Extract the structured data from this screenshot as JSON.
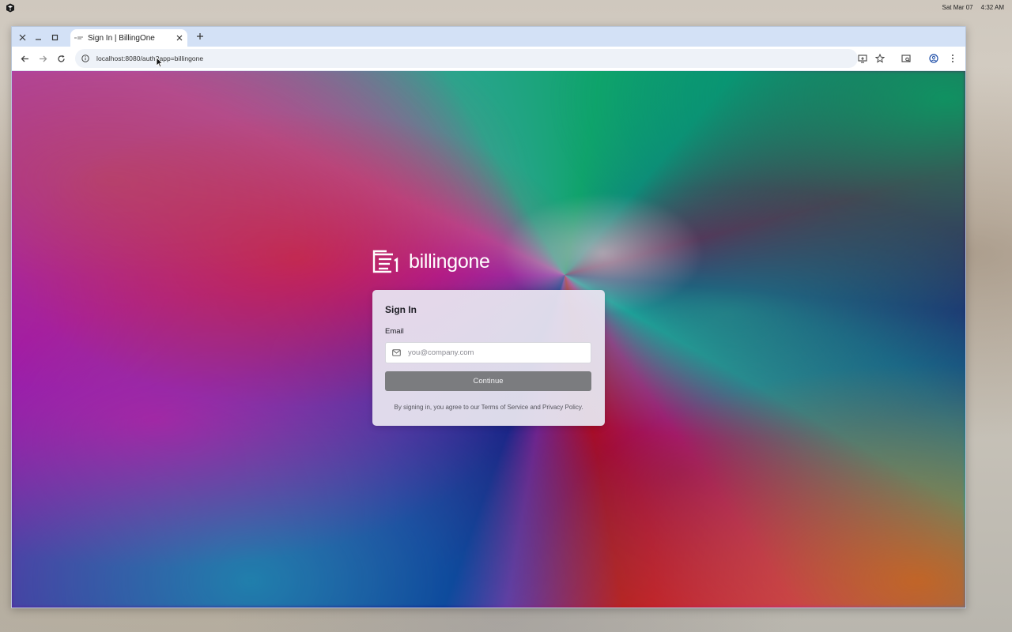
{
  "system": {
    "date": "Sat Mar 07",
    "time": "4:32 AM"
  },
  "browser": {
    "tab": {
      "title": "Sign In | BillingOne"
    },
    "url": "localhost:8080/auth?app=billingone"
  },
  "page": {
    "brand_name": "billingone",
    "card": {
      "title": "Sign In",
      "email_label": "Email",
      "email_placeholder": "you@company.com",
      "email_value": "",
      "continue_label": "Continue",
      "legal_text": "By signing in, you agree to our Terms of Service and Privacy Policy."
    }
  },
  "colors": {
    "tabstrip": "#d3e1f6",
    "button_disabled": "#7b7c7f"
  }
}
